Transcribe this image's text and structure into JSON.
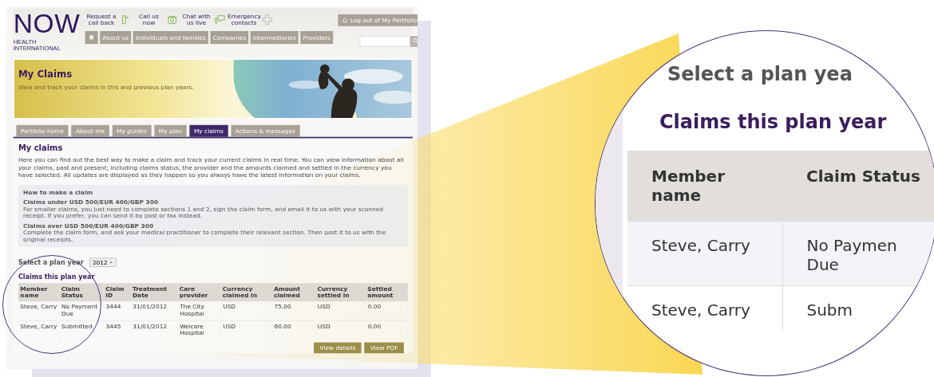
{
  "header": {
    "logo": "NOW",
    "tagline": "HEALTH INTERNATIONAL",
    "quick_links": [
      {
        "label": "Request a call back",
        "kind": "callback"
      },
      {
        "label": "Call us now",
        "kind": "phone"
      },
      {
        "label": "Chat with us live",
        "kind": "chat"
      },
      {
        "label": "Emergency contacts",
        "kind": "cross"
      }
    ],
    "logout_button": "Log out of My Portfolio",
    "nav": [
      "About us",
      "Individuals and families",
      "Companies",
      "Intermediaries",
      "Providers"
    ],
    "search": {
      "kind": "search"
    }
  },
  "banner": {
    "title": "My Claims",
    "subtitle": "View and track your claims in this and previous plan years.",
    "kind": "picture"
  },
  "tabs": [
    {
      "label": "Portfolio home",
      "selected": false
    },
    {
      "label": "About me",
      "selected": false
    },
    {
      "label": "My guides",
      "selected": false
    },
    {
      "label": "My plan",
      "selected": false
    },
    {
      "label": "My claims",
      "selected": true
    },
    {
      "label": "Actions & messages",
      "selected": false
    }
  ],
  "section_title": "My claims",
  "intro": "Here you can find out the best way to make a claim and track your current claims in real time. You can view information about all your claims, past and present, including claims status, the provider and the amounts claimed and settled in the currency you have selected. All updates are displayed as they happen so you always have the latest information on your claims.",
  "how_to": {
    "title": "How to make a claim",
    "items": [
      {
        "title": "Claims under USD 500/EUR 400/GBP 300",
        "text": "For smaller claims, you just need to complete sections 1 and 2, sign the claim form, and email it to us with your scanned receipt. If you prefer, you can send it by post or fax instead."
      },
      {
        "title": "Claims over USD 500/EUR 400/GBP 300",
        "text": "Complete the claim form, and ask your medical practitioner to complete their relevant section. Then post it to us with the original receipts."
      }
    ]
  },
  "plan_year": {
    "label": "Select a plan year",
    "value": "2012"
  },
  "claims": {
    "title": "Claims this plan year",
    "columns": [
      "Member name",
      "Claim Status",
      "Claim ID",
      "Treatment Date",
      "Care provider",
      "Currency claimed in",
      "Amount claimed",
      "Currency settled in",
      "Settled amount"
    ],
    "rows": [
      [
        "Steve, Carry",
        "No Payment Due",
        "3444",
        "31/01/2012",
        "The City Hospital",
        "USD",
        "75.00",
        "USD",
        "0.00"
      ],
      [
        "Steve, Carry",
        "Submitted",
        "3445",
        "31/01/2012",
        "Welcare Hospital",
        "USD",
        "60.00",
        "USD",
        "0.00"
      ]
    ]
  },
  "buttons": [
    "View details",
    "View PDF"
  ],
  "magnifier": {
    "plan_year_label": "Select a plan yea",
    "claims_title": "Claims this plan year",
    "columns": [
      "Member name",
      "Claim Status"
    ],
    "rows": [
      [
        "Steve, Carry",
        "No Paymen Due"
      ],
      [
        "Steve, Carry",
        "Subm"
      ]
    ]
  }
}
